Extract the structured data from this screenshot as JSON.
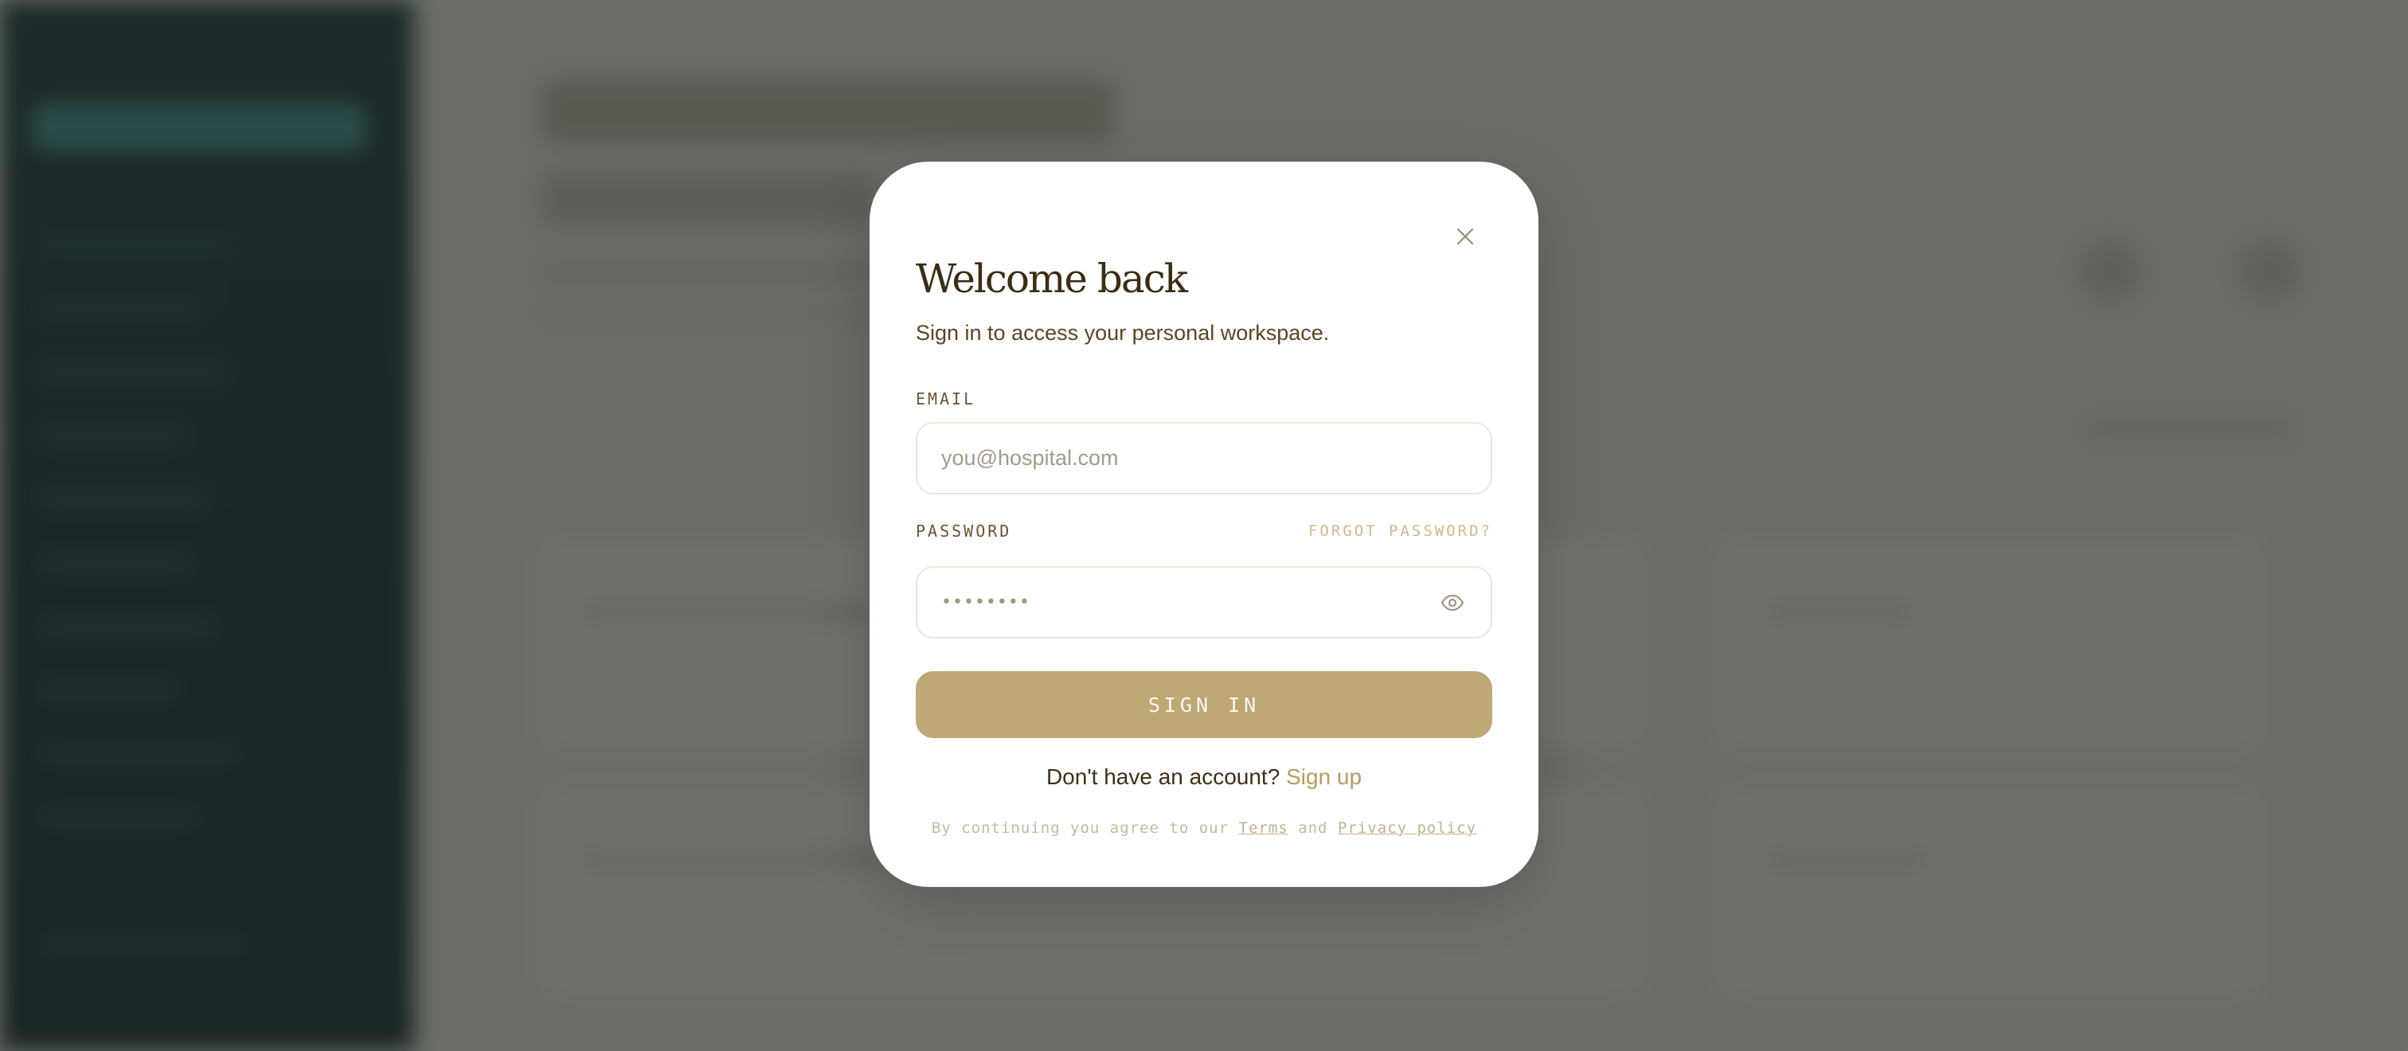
{
  "modal": {
    "title": "Welcome back",
    "subtitle": "Sign in to access your personal workspace.",
    "close_icon": "close-icon"
  },
  "email": {
    "label": "EMAIL",
    "placeholder": "you@hospital.com",
    "value": ""
  },
  "password": {
    "label": "PASSWORD",
    "forgot_label": "FORGOT PASSWORD?",
    "masked_value": "••••••••",
    "toggle_icon": "eye-icon"
  },
  "actions": {
    "signin_label": "SIGN IN",
    "signup_prompt": "Don't have an account?",
    "signup_link": "Sign up"
  },
  "legal": {
    "prefix": "By continuing you agree to our",
    "terms": "Terms",
    "conjunction": "and",
    "privacy": "Privacy policy"
  },
  "colors": {
    "accent": "#bfa876",
    "title": "#3a2d14",
    "link": "#b99a5e",
    "sidebar": "#0e1f1f",
    "backdrop": "#6e716b"
  }
}
